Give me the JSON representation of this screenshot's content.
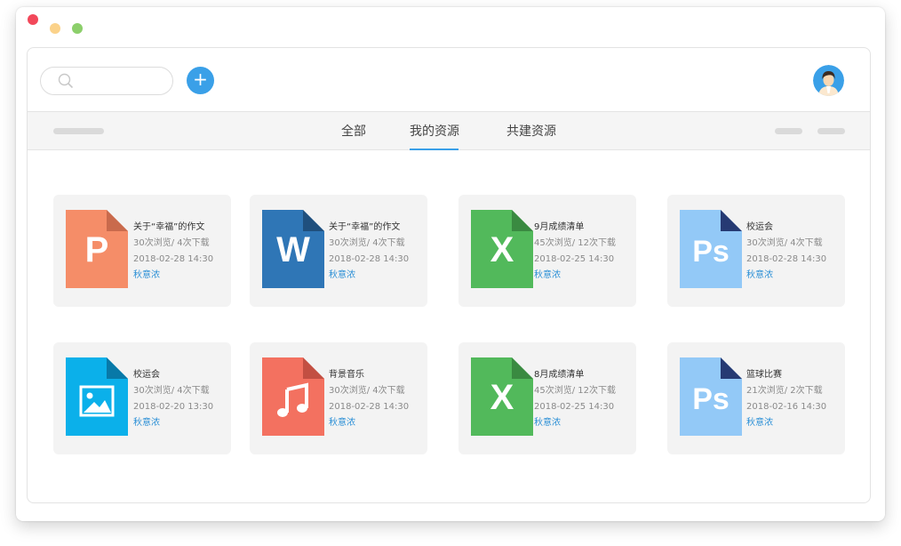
{
  "colors": {
    "accent": "#3aa0e8",
    "traffic_red": "#f2485a",
    "traffic_yellow": "#fbd28a",
    "traffic_green": "#8ccf6b"
  },
  "search": {
    "placeholder": "",
    "icon": "search-icon"
  },
  "header": {
    "add_icon": "plus-icon",
    "add_label": "+",
    "avatar": "avatar"
  },
  "tabs": [
    {
      "label": "全部",
      "active": false
    },
    {
      "label": "我的资源",
      "active": true
    },
    {
      "label": "共建资源",
      "active": false
    }
  ],
  "files": [
    {
      "type": "ppt",
      "letter": "P",
      "color": "#f58d68",
      "fold": "#c96a4c",
      "title": "关于“幸福”的作文",
      "stats": "30次浏览/ 4次下载",
      "date": "2018-02-28 14:30",
      "author": "秋意浓"
    },
    {
      "type": "word",
      "letter": "W",
      "color": "#2f76b6",
      "fold": "#1f4f7d",
      "title": "关于“幸福”的作文",
      "stats": "30次浏览/ 4次下载",
      "date": "2018-02-28 14:30",
      "author": "秋意浓"
    },
    {
      "type": "excel",
      "letter": "X",
      "color": "#52b95b",
      "fold": "#3a8a41",
      "title": "9月成绩清单",
      "stats": "45次浏览/ 12次下载",
      "date": "2018-02-25 14:30",
      "author": "秋意浓"
    },
    {
      "type": "ps",
      "letter": "Ps",
      "color": "#93c9f7",
      "fold": "#263a73",
      "title": "校运会",
      "stats": "30次浏览/ 4次下载",
      "date": "2018-02-28 14:30",
      "author": "秋意浓"
    },
    {
      "type": "image",
      "letter": "",
      "color": "#0bb0ea",
      "fold": "#0879a8",
      "title": "校运会",
      "stats": "30次浏览/ 4次下载",
      "date": "2018-02-20 13:30",
      "author": "秋意浓"
    },
    {
      "type": "music",
      "letter": "",
      "color": "#f37160",
      "fold": "#c24f42",
      "title": "背景音乐",
      "stats": "30次浏览/ 4次下载",
      "date": "2018-02-28 14:30",
      "author": "秋意浓"
    },
    {
      "type": "excel",
      "letter": "X",
      "color": "#52b95b",
      "fold": "#3a8a41",
      "title": "8月成绩清单",
      "stats": "45次浏览/ 12次下载",
      "date": "2018-02-25 14:30",
      "author": "秋意浓"
    },
    {
      "type": "ps",
      "letter": "Ps",
      "color": "#93c9f7",
      "fold": "#263a73",
      "title": "篮球比赛",
      "stats": "21次浏览/ 2次下载",
      "date": "2018-02-16 14:30",
      "author": "秋意浓"
    }
  ]
}
